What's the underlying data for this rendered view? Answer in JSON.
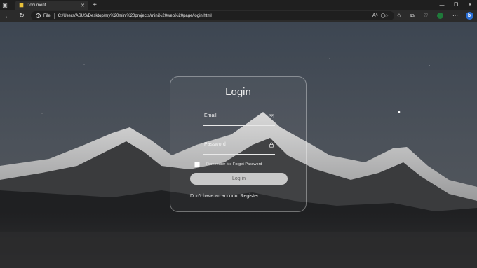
{
  "browser": {
    "tab_title": "Document",
    "tab_close": "✕",
    "new_tab": "+",
    "address_info": "i",
    "address_scheme": "File",
    "address_url": "C:/Users/ASUS/Desktop/my%20mini%20projects/mini%20web%20page/login.html",
    "bing_label": "b"
  },
  "login": {
    "title": "Login",
    "email_label": "Email",
    "password_label": "Password",
    "remember_text": "Remember Me Forget Password",
    "button_label": "Log in",
    "register_text": "Don't have an account Register"
  },
  "colors": {
    "card_border": "#8a8a8a",
    "button_bg": "#c9c9c9",
    "text": "#eeeeee"
  }
}
